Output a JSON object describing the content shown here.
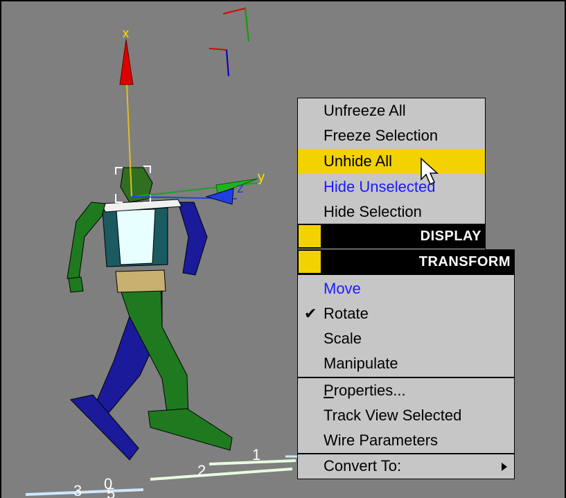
{
  "viewport": {
    "background": "#7f7f7f",
    "gizmo_axis_labels": {
      "x": "x",
      "y": "y",
      "z": "z"
    },
    "ground_labels": [
      "1",
      "2",
      "3",
      "0",
      "5"
    ]
  },
  "menu": {
    "items_top": [
      {
        "label": "Unfreeze All",
        "style": "normal"
      },
      {
        "label": "Freeze Selection",
        "style": "normal"
      },
      {
        "label": "Unhide All",
        "style": "highlighted"
      },
      {
        "label": "Hide Unselected",
        "style": "blue"
      },
      {
        "label": "Hide Selection",
        "style": "normal"
      }
    ],
    "headers": [
      "DISPLAY",
      "TRANSFORM"
    ],
    "transform_items": [
      {
        "label": "Move",
        "style": "blue"
      },
      {
        "label": "Rotate",
        "style": "checked"
      },
      {
        "label": "Scale",
        "style": "normal"
      },
      {
        "label": "Manipulate",
        "style": "normal"
      }
    ],
    "bottom_items": [
      {
        "label_first": "P",
        "label_rest": "roperties...",
        "style": "normal"
      },
      {
        "label": "Track View Selected",
        "style": "normal"
      },
      {
        "label": "Wire Parameters",
        "style": "normal"
      }
    ],
    "submenu_item": {
      "label": "Convert To:",
      "icon": "submenu-arrow-icon"
    },
    "checkmark": "✔",
    "highlight_color": "#f2d200",
    "menu_background": "#c6c6c6",
    "blue_text_color": "#1a1aff"
  }
}
